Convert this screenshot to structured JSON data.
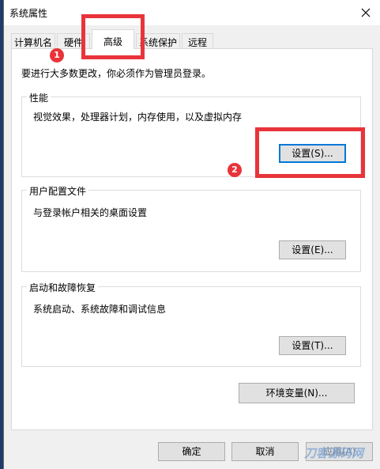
{
  "window": {
    "title": "系统属性"
  },
  "tabs": [
    {
      "label": "计算机名"
    },
    {
      "label": "硬件"
    },
    {
      "label": "高级"
    },
    {
      "label": "系统保护"
    },
    {
      "label": "远程"
    }
  ],
  "active_tab": "高级",
  "intro_text": "要进行大多数更改，你必须作为管理员登录。",
  "groups": {
    "performance": {
      "title": "性能",
      "description": "视觉效果，处理器计划，内存使用，以及虚拟内存",
      "button": "设置(S)..."
    },
    "user_profiles": {
      "title": "用户配置文件",
      "description": "与登录帐户相关的桌面设置",
      "button": "设置(E)..."
    },
    "startup_recovery": {
      "title": "启动和故障恢复",
      "description": "系统启动、系统故障和调试信息",
      "button": "设置(T)..."
    }
  },
  "env_button": "环境变量(N)...",
  "footer": {
    "ok": "确定",
    "cancel": "取消",
    "apply": "应用(A)"
  },
  "annotations": {
    "marker1": "1",
    "marker2": "2"
  },
  "watermark": "刀客源码网",
  "colors": {
    "highlight": "#e8343a",
    "focus": "#0078d7"
  }
}
